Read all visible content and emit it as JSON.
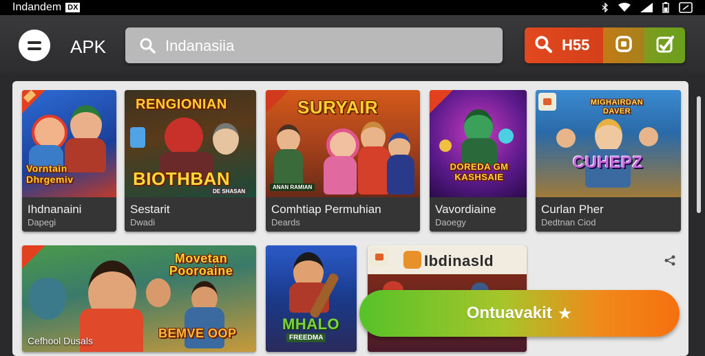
{
  "status_bar": {
    "left_text": "Indandem",
    "left_badge": "DX",
    "icons": [
      "bluetooth-icon",
      "wifi-icon",
      "signal-icon",
      "battery-icon",
      "screen-icon"
    ]
  },
  "header": {
    "menu_icon": "hamburger-icon",
    "app_title": "APK",
    "search": {
      "placeholder": "",
      "value": "Indanasiia",
      "icon": "search-icon"
    },
    "actions": {
      "search_count": "H55",
      "mid_icon": "square-icon",
      "right_icon": "edit-check-icon"
    }
  },
  "grid": {
    "row1": [
      {
        "art_text": "Vorntain Dhrgemiv",
        "title": "Ihdnanaini",
        "subtitle": "Dapegi",
        "marker": "ribbon"
      },
      {
        "art_text_top": "RENGIONIAN",
        "art_text": "BIOTHBAN",
        "art_small": "DE SHASAN",
        "title": "Sestarit",
        "subtitle": "Dwadi",
        "marker": "none"
      },
      {
        "art_text": "SURYAIR",
        "art_small": "ANAN RAMIAN",
        "title": "Comhtiap Permuhian",
        "subtitle": "Deards",
        "marker": "ribbon"
      },
      {
        "art_text": "DOREDA GM KASHSAIE",
        "title": "Vavordiaine",
        "subtitle": "Daoegy",
        "marker": "ribbon"
      },
      {
        "art_text_top": "MIGHAIRDAN DAVER",
        "art_text": "CUHEPZ",
        "title": "Curlan Pher",
        "subtitle": "Dedtnan Ciod",
        "marker": "badge"
      }
    ],
    "row2": [
      {
        "art_text": "Movetan Pooroaine",
        "art_small": "BEMVE OOP",
        "caption": "Cefhool Dusals",
        "marker": "ribbon"
      },
      {
        "art_text": "MHALO",
        "art_small": "FREEDMA",
        "marker": "none"
      },
      {
        "art_text": "Ibdinasld",
        "marker": "badge"
      }
    ]
  },
  "cta": {
    "label": "Ontuavakit",
    "icon": "star-icon"
  },
  "share_icon": "share-icon",
  "colors": {
    "accent_orange": "#e2481e",
    "accent_green": "#56c229",
    "cta_end": "#f5700f"
  }
}
